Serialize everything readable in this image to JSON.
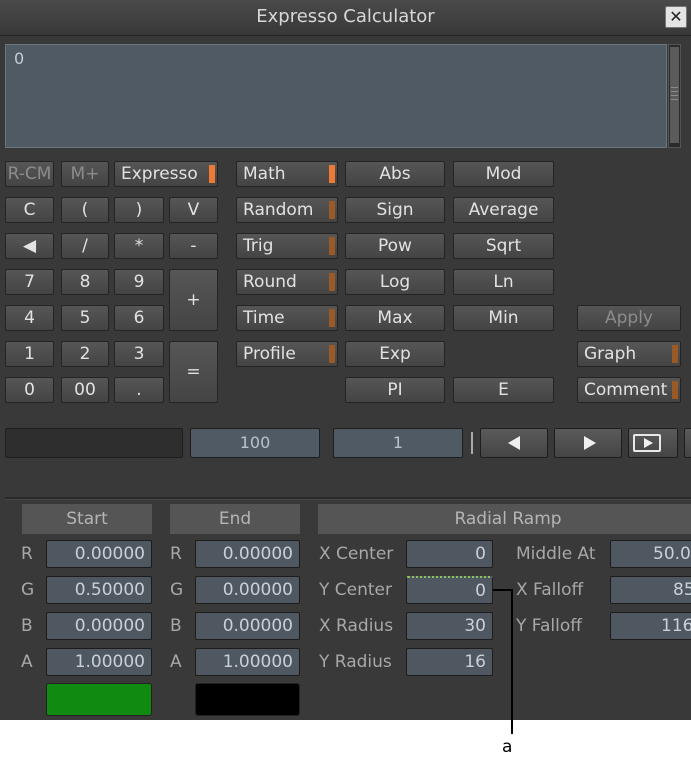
{
  "window": {
    "title": "Expresso Calculator",
    "close_icon": "close-icon"
  },
  "display": {
    "value": "0"
  },
  "keypad": {
    "rcm": "R-CM",
    "mplus": "M+",
    "expresso": "Expresso",
    "clear": "C",
    "lparen": "(",
    "rparen": ")",
    "v": "V",
    "backspace": "◀",
    "divide": "/",
    "multiply": "*",
    "minus": "-",
    "seven": "7",
    "eight": "8",
    "nine": "9",
    "plus": "+",
    "four": "4",
    "five": "5",
    "six": "6",
    "one": "1",
    "two": "2",
    "three": "3",
    "equals": "=",
    "zero": "0",
    "double_zero": "00",
    "dot": "."
  },
  "categories": [
    "Math",
    "Random",
    "Trig",
    "Round",
    "Time",
    "Profile"
  ],
  "functions": {
    "abs": "Abs",
    "mod": "Mod",
    "sign": "Sign",
    "average": "Average",
    "pow": "Pow",
    "sqrt": "Sqrt",
    "log": "Log",
    "ln": "Ln",
    "max": "Max",
    "min": "Min",
    "exp": "Exp",
    "pi": "PI",
    "e": "E"
  },
  "side": {
    "apply": "Apply",
    "graph": "Graph",
    "comment": "Comment"
  },
  "timeline": {
    "field1": "100",
    "field2": "1"
  },
  "start": {
    "header": "Start",
    "labels": [
      "R",
      "G",
      "B",
      "A"
    ],
    "values": [
      "0.00000",
      "0.50000",
      "0.00000",
      "1.00000"
    ],
    "color": "#118a11"
  },
  "end": {
    "header": "End",
    "labels": [
      "R",
      "G",
      "B",
      "A"
    ],
    "values": [
      "0.00000",
      "0.00000",
      "0.00000",
      "1.00000"
    ],
    "color": "#000000"
  },
  "ramp": {
    "header": "Radial Ramp",
    "x_center_label": "X Center",
    "x_center": "0",
    "y_center_label": "Y Center",
    "y_center": "0",
    "x_radius_label": "X Radius",
    "x_radius": "30",
    "y_radius_label": "Y Radius",
    "y_radius": "16",
    "middle_at_label": "Middle At",
    "middle_at": "50.0",
    "x_falloff_label": "X Falloff",
    "x_falloff": "85",
    "y_falloff_label": "Y Falloff",
    "y_falloff": "116"
  },
  "callout": {
    "label": "a"
  }
}
